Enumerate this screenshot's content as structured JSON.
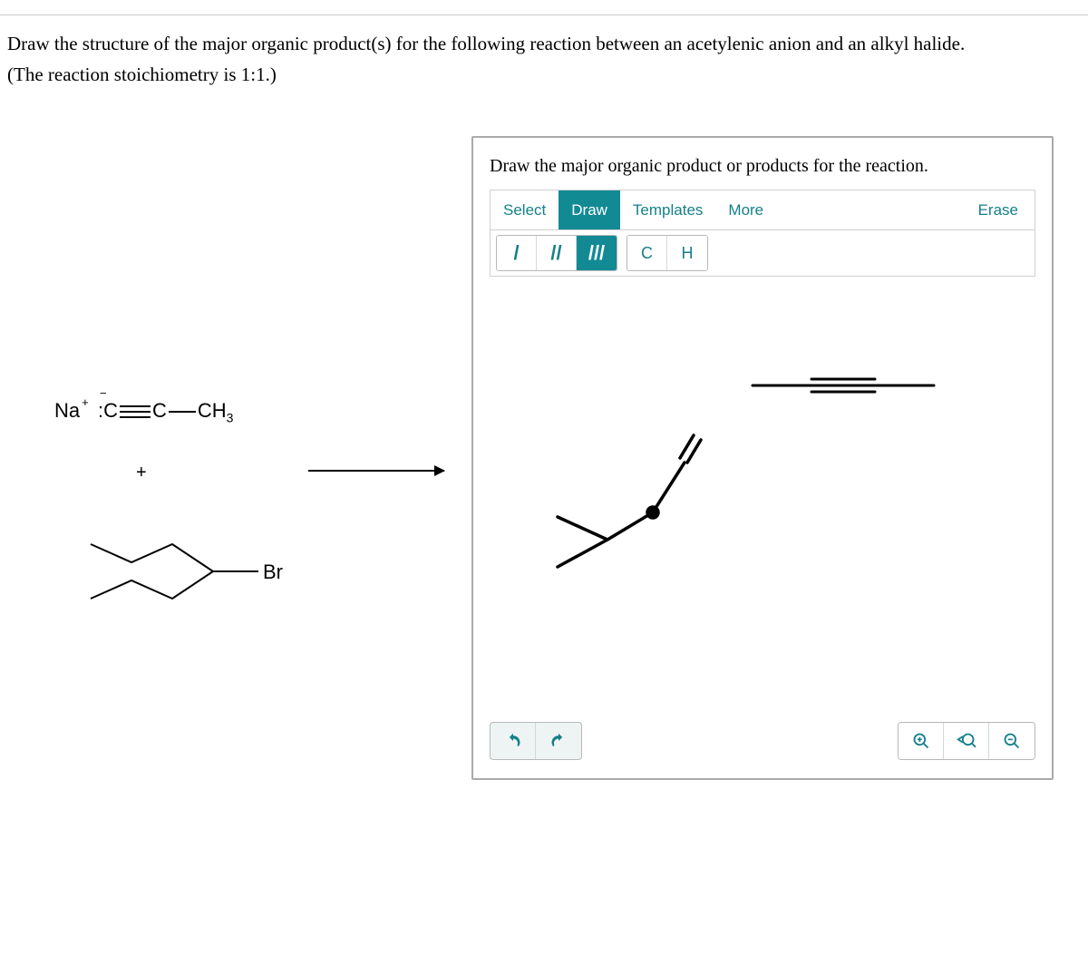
{
  "question": {
    "prompt_line1": "Draw the structure of the major organic product(s) for the following reaction between an acetylenic anion and an alkyl halide.",
    "prompt_line2": "(The reaction stoichiometry is 1:1.)"
  },
  "reactants": {
    "acetylide": {
      "cation": "Na",
      "cation_charge": "+",
      "anion_prefix": ":C",
      "anion_charge": "−",
      "right_group": "CH",
      "right_sub": "3"
    },
    "plus": "+",
    "halide_label": "Br"
  },
  "panel": {
    "title": "Draw the major organic product or products for the reaction.",
    "tabs": {
      "select": "Select",
      "draw": "Draw",
      "templates": "Templates",
      "more": "More"
    },
    "erase": "Erase",
    "bond_tools": {
      "single": "/",
      "double": "//",
      "triple": "///"
    },
    "atom_tools": {
      "c": "C",
      "h": "H"
    },
    "icons": {
      "undo": "undo-icon",
      "redo": "redo-icon",
      "zoom_in": "zoom-in-icon",
      "zoom_reset": "zoom-reset-icon",
      "zoom_out": "zoom-out-icon"
    }
  }
}
